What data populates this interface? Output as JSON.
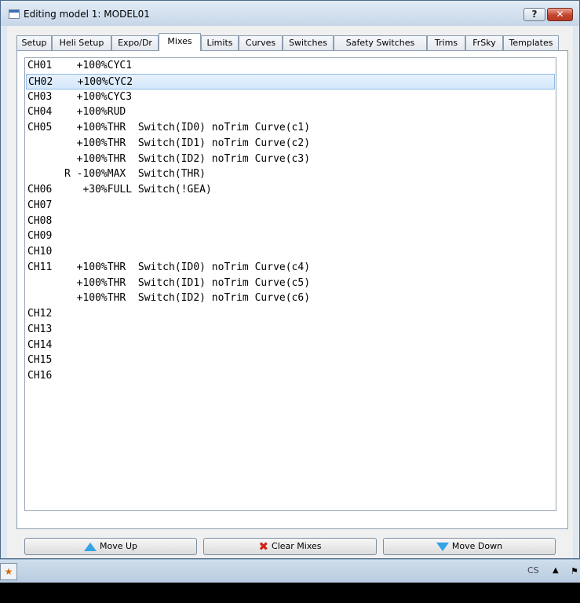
{
  "window": {
    "title": "Editing model 1: MODEL01",
    "help_label": "?",
    "close_label": "✕"
  },
  "tabs": [
    {
      "label": "Setup"
    },
    {
      "label": "Heli Setup"
    },
    {
      "label": "Expo/Dr"
    },
    {
      "label": "Mixes",
      "active": true
    },
    {
      "label": "Limits"
    },
    {
      "label": "Curves"
    },
    {
      "label": "Switches"
    },
    {
      "label": "Safety Switches"
    },
    {
      "label": "Trims"
    },
    {
      "label": "FrSky"
    },
    {
      "label": "Templates"
    }
  ],
  "mixes": [
    "CH01    +100%CYC1",
    "CH02    +100%CYC2",
    "CH03    +100%CYC3",
    "CH04    +100%RUD",
    "CH05    +100%THR  Switch(ID0) noTrim Curve(c1)",
    "        +100%THR  Switch(ID1) noTrim Curve(c2)",
    "        +100%THR  Switch(ID2) noTrim Curve(c3)",
    "      R -100%MAX  Switch(THR)",
    "CH06     +30%FULL Switch(!GEA)",
    "CH07",
    "CH08",
    "CH09",
    "CH10",
    "CH11    +100%THR  Switch(ID0) noTrim Curve(c4)",
    "        +100%THR  Switch(ID1) noTrim Curve(c5)",
    "        +100%THR  Switch(ID2) noTrim Curve(c6)",
    "CH12",
    "CH13",
    "CH14",
    "CH15",
    "CH16"
  ],
  "selected_row": 1,
  "buttons": {
    "move_up": "Move Up",
    "clear_mixes": "Clear Mixes",
    "move_down": "Move Down"
  },
  "taskbar": {
    "language": "CS",
    "tray_arrow": "▲"
  }
}
